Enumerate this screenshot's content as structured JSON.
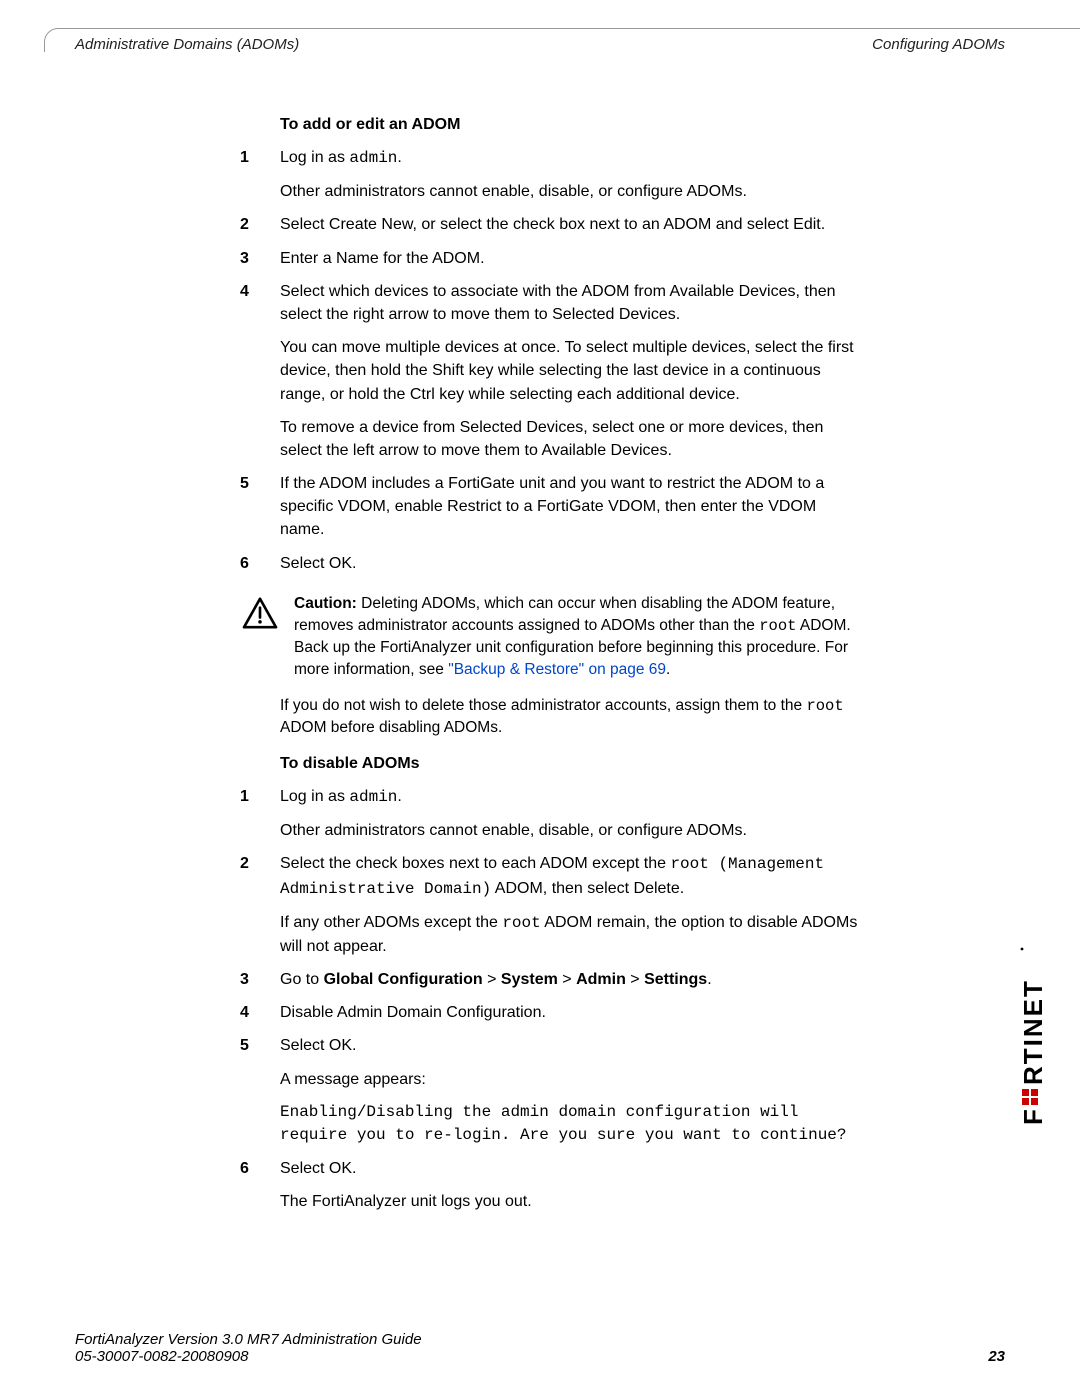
{
  "header": {
    "left": "Administrative Domains (ADOMs)",
    "right": "Configuring ADOMs"
  },
  "section1": {
    "heading": "To add or edit an ADOM",
    "steps": [
      {
        "num": "1",
        "p1_pre": "Log in as ",
        "p1_mono": "admin",
        "p1_post": ".",
        "p2": "Other administrators cannot enable, disable, or configure ADOMs."
      },
      {
        "num": "2",
        "p1": "Select Create New, or select the check box next to an ADOM and select Edit."
      },
      {
        "num": "3",
        "p1": "Enter a Name for the ADOM."
      },
      {
        "num": "4",
        "p1": "Select which devices to associate with the ADOM from Available Devices, then select the right arrow to move them to Selected Devices.",
        "p2": "You can move multiple devices at once. To select multiple devices, select the first device, then hold the Shift key while selecting the last device in a continuous range, or hold the Ctrl key while selecting each additional device.",
        "p3": "To remove a device from Selected Devices, select one or more devices, then select the left arrow to move them to Available Devices."
      },
      {
        "num": "5",
        "p1": "If the ADOM includes a FortiGate unit and you want to restrict the ADOM to a specific VDOM, enable Restrict to a FortiGate VDOM, then enter the VDOM name."
      },
      {
        "num": "6",
        "p1": "Select OK."
      }
    ]
  },
  "caution": {
    "label": "Caution:",
    "t1": " Deleting ADOMs, which can occur when disabling the ADOM feature, removes administrator accounts assigned to ADOMs other than the ",
    "m1": "root",
    "t2": " ADOM. Back up the FortiAnalyzer unit configuration before beginning this procedure. For more information, see ",
    "link": "\"Backup & Restore\" on page 69",
    "t3": "."
  },
  "followup": {
    "t1": "If you do not wish to delete those administrator accounts, assign them to the ",
    "m1": "root",
    "t2": " ADOM before disabling ADOMs."
  },
  "section2": {
    "heading": "To disable ADOMs",
    "steps": {
      "s1": {
        "num": "1",
        "p1_pre": "Log in as ",
        "p1_mono": "admin",
        "p1_post": ".",
        "p2": "Other administrators cannot enable, disable, or configure ADOMs."
      },
      "s2": {
        "num": "2",
        "p1_a": "Select the check boxes next to each ADOM except the ",
        "p1_m1": "root (Management Administrative Domain)",
        "p1_b": " ADOM, then select Delete.",
        "p2_a": "If any other ADOMs except the ",
        "p2_m": "root",
        "p2_b": " ADOM remain, the option to disable ADOMs will not appear."
      },
      "s3": {
        "num": "3",
        "pre": "Go to ",
        "b1": "Global Configuration",
        "sep": " > ",
        "b2": "System",
        "b3": "Admin",
        "b4": "Settings",
        "post": "."
      },
      "s4": {
        "num": "4",
        "p1": "Disable Admin Domain Configuration."
      },
      "s5": {
        "num": "5",
        "p1": "Select OK.",
        "p2": "A message appears:",
        "msg": "Enabling/Disabling the admin domain configuration will require you to re-login. Are you sure you want to continue?"
      },
      "s6": {
        "num": "6",
        "p1": "Select OK.",
        "p2": "The FortiAnalyzer unit logs you out."
      }
    }
  },
  "footer": {
    "line1": "FortiAnalyzer Version 3.0 MR7 Administration Guide",
    "line2": "05-30007-0082-20080908",
    "page": "23"
  }
}
